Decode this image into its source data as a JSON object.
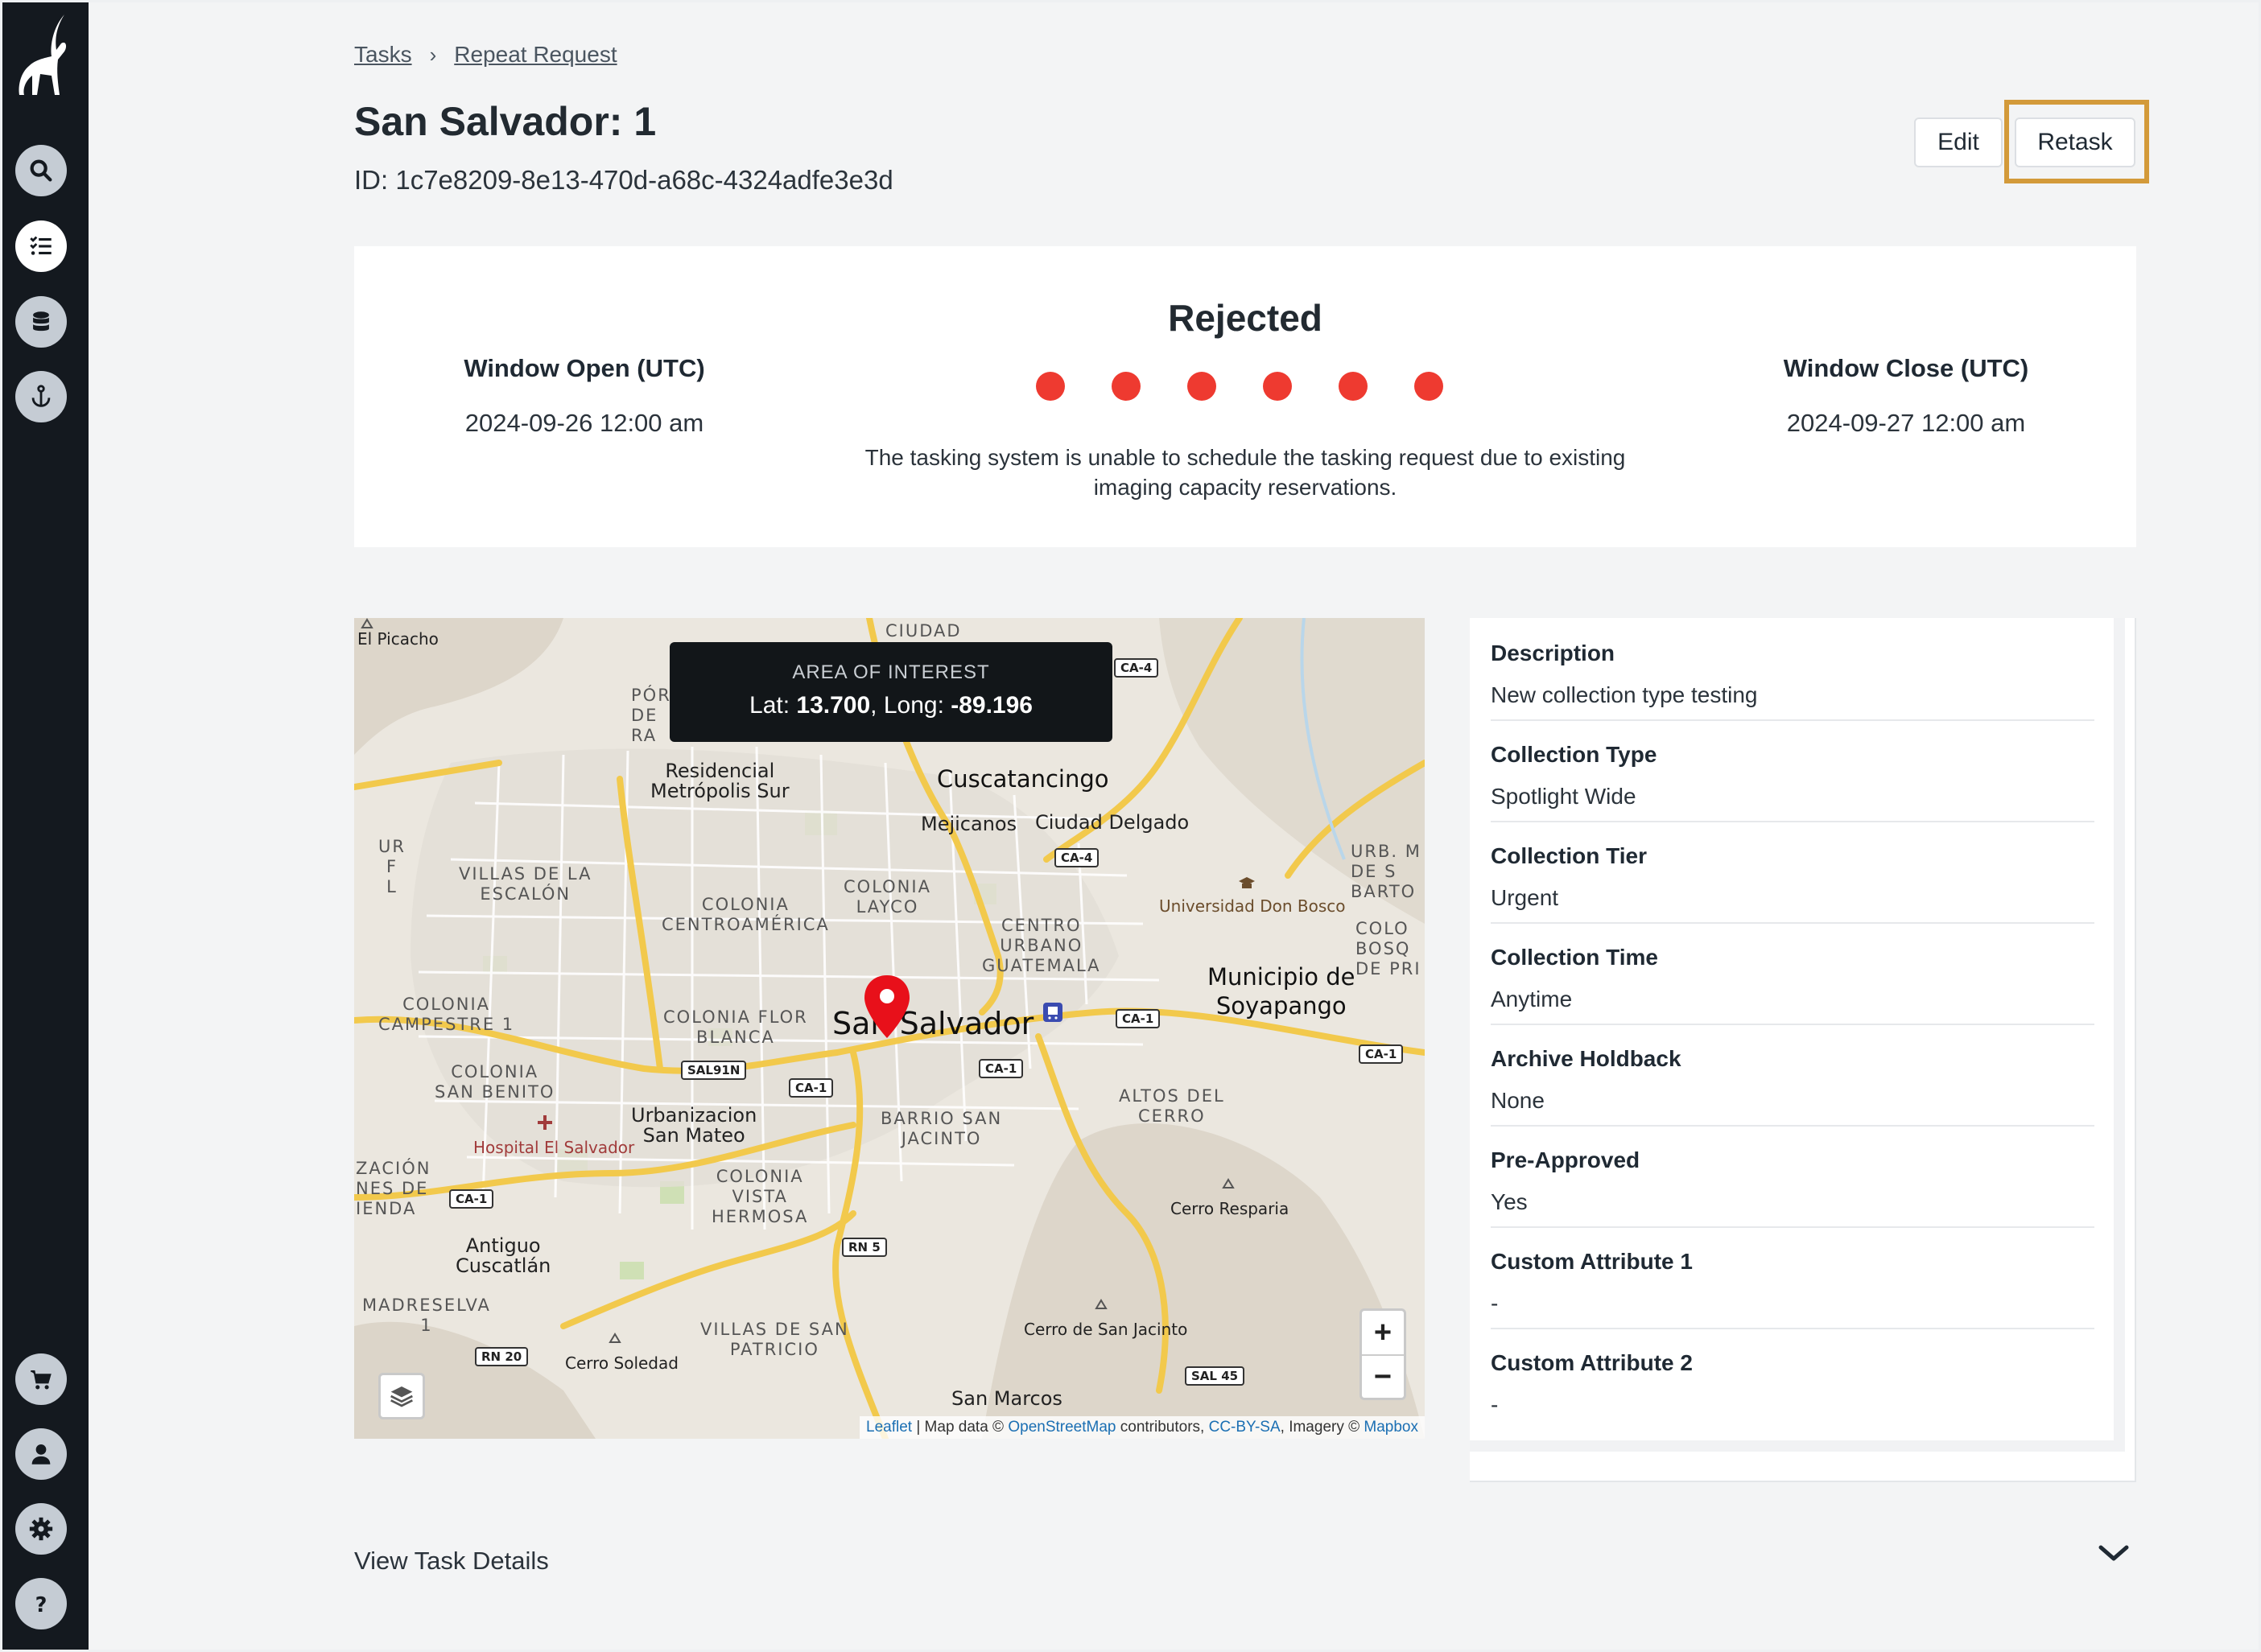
{
  "breadcrumb": {
    "tasks": "Tasks",
    "separator": "›",
    "current": "Repeat Request"
  },
  "header": {
    "title": "San Salvador: 1",
    "id_text": "ID: 1c7e8209-8e13-470d-a68c-4324adfe3e3d",
    "edit_label": "Edit",
    "retask_label": "Retask"
  },
  "status": {
    "title": "Rejected",
    "window_open_label": "Window Open (UTC)",
    "window_open_value": "2024-09-26 12:00 am",
    "window_close_label": "Window Close (UTC)",
    "window_close_value": "2024-09-27 12:00 am",
    "message": "The tasking system is unable to schedule the tasking request due to existing imaging capacity reservations.",
    "dot_color": "#ee3a30",
    "dot_count": 6
  },
  "map": {
    "tooltip_title": "AREA OF INTEREST",
    "lat_label": "Lat: ",
    "lat_value": "13.700",
    "long_label": ", Long: ",
    "long_value": "-89.196",
    "zoom_in": "+",
    "zoom_out": "−",
    "attribution": {
      "leaflet": "Leaflet",
      "sep1": " | Map data © ",
      "osm": "OpenStreetMap",
      "contrib": " contributors, ",
      "license": "CC-BY-SA",
      "imagery": ", Imagery © ",
      "mapbox": "Mapbox"
    },
    "labels": {
      "el_picacho": "El Picacho",
      "ciudad": "CIUDAD",
      "por": "PÓR\nDE\nRA",
      "residencial": "Residencial\nMetrópolis Sur",
      "cuscatancingo": "Cuscatancingo",
      "mejicanos": "Mejicanos",
      "ciudad_delgado": "Ciudad Delgado",
      "villas_escalon": "VILLAS DE LA\nESCALÓN",
      "colonia_centroamerica": "COLONIA\nCENTROAMÉRICA",
      "colonia_layco": "COLONIA\nLAYCO",
      "centro_urbano": "CENTRO\nURBANO\nGUATEMALA",
      "universidad": "Universidad Don Bosco",
      "urb": "URB. M\nDE S\nBARTO",
      "municipio": "Municipio de\nSoyapango",
      "colonia_campestre": "COLONIA\nCAMPESTRE 1",
      "colonia_flor_blanca": "COLONIA FLOR\nBLANCA",
      "san_salvador": "San Salvador",
      "colonia_san_benito": "COLONIA\nSAN BENITO",
      "urbanizacion": "Urbanizacion\nSan Mateo",
      "barrio": "BARRIO SAN\nJACINTO",
      "altos": "ALTOS DEL\nCERRO",
      "hospital": "Hospital El Salvador",
      "zacion": "ZACIÓN\nNES DE\nIENDA",
      "colonia_vista": "COLONIA\nVISTA\nHERMOSA",
      "cerro_resparia": "Cerro Resparia",
      "antiguo": "Antiguo\nCuscatlán",
      "madreselva": "MADRESELVA\n1",
      "villas_patricio": "VILLAS DE SAN\nPATRICIO",
      "cerro_jacinto": "Cerro de San Jacinto",
      "cerro_soledad": "Cerro Soledad",
      "san_marcos": "San Marcos",
      "ur": "UR\nF\nL",
      "colo_bosq": "COLO\nBOSQ\nDE PRI"
    },
    "shields": {
      "ca4_top": "CA-4",
      "ca4_mid": "CA-4",
      "ca1_east": "CA-1",
      "ca1_far_east": "CA-1",
      "sal91n": "SAL91N",
      "ca1_center": "CA-1",
      "ca1_center2": "CA-1",
      "ca1_west": "CA-1",
      "rn5": "RN 5",
      "rn20": "RN 20",
      "sal45": "SAL 45"
    }
  },
  "details": {
    "items": [
      {
        "label": "Description",
        "value": "New collection type testing"
      },
      {
        "label": "Collection Type",
        "value": "Spotlight Wide"
      },
      {
        "label": "Collection Tier",
        "value": "Urgent"
      },
      {
        "label": "Collection Time",
        "value": "Anytime"
      },
      {
        "label": "Archive Holdback",
        "value": "None"
      },
      {
        "label": "Pre-Approved",
        "value": "Yes"
      },
      {
        "label": "Custom Attribute 1",
        "value": "-"
      },
      {
        "label": "Custom Attribute 2",
        "value": "-"
      }
    ]
  },
  "footer": {
    "view_details": "View Task Details"
  },
  "icons": {
    "logo": "ibex-logo-icon",
    "search": "search-icon",
    "tasks": "task-list-icon",
    "database": "database-icon",
    "anchor": "anchor-icon",
    "cart": "cart-icon",
    "user": "user-icon",
    "settings": "gear-icon",
    "help": "help-icon"
  },
  "colors": {
    "sidebar": "#14191f",
    "accent_highlight": "#d39a3a",
    "status_red": "#ee3a30",
    "pin": "#e8101a"
  }
}
